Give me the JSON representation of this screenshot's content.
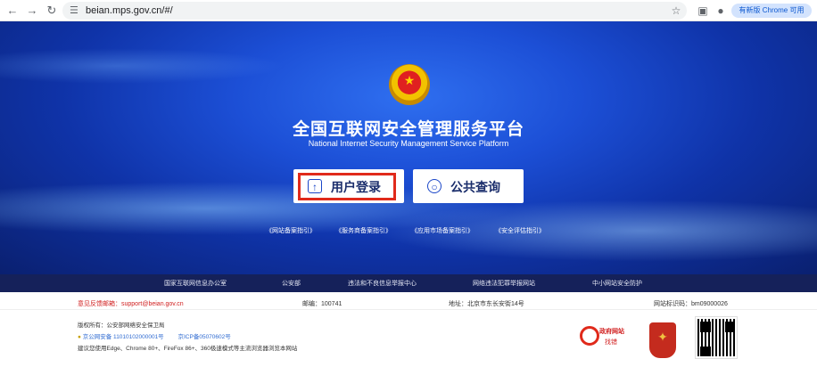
{
  "browser": {
    "url": "beian.mps.gov.cn/#/",
    "update_pill": "有新版 Chrome 可用"
  },
  "hero": {
    "title_cn": "全国互联网安全管理服务平台",
    "title_en": "National Internet Security Management Service Platform",
    "login_label": "用户登录",
    "query_label": "公共查询",
    "guides": [
      "《网站备案指引》",
      "《服务商备案指引》",
      "《应用市场备案指引》",
      "《安全评估指引》"
    ]
  },
  "footer_nav": [
    "国家互联网信息办公室",
    "公安部",
    "违法和不良信息举报中心",
    "网络违法犯罪举报网站",
    "中小网站安全防护"
  ],
  "info": {
    "email": "意见反馈邮箱：support@beian.gov.cn",
    "postcode": "邮编：100741",
    "address": "地址：北京市东长安街14号",
    "site_id": "网站标识码：bm09000026"
  },
  "copyright": {
    "owner": "版权所有：公安部网络安全保卫局",
    "police_record": "京公网安备 11010102000001号",
    "icp": "京ICP备05070602号",
    "browser_tip": "建议您使用Edge、Chrome 80+、FireFox 86+、360极速模式等主流浏览器浏览本网站"
  },
  "gov_logo": {
    "text": "政府网站",
    "sub": "找错"
  }
}
